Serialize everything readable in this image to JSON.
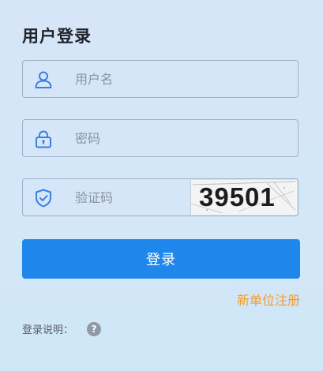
{
  "form": {
    "title": "用户登录",
    "username": {
      "placeholder": "用户名",
      "value": ""
    },
    "password": {
      "placeholder": "密码",
      "value": ""
    },
    "captcha": {
      "placeholder": "验证码",
      "value": "",
      "image_text": "39501"
    },
    "login_label": "登录",
    "register_label": "新单位注册",
    "note_label": "登录说明：",
    "help_glyph": "?"
  },
  "colors": {
    "accent": "#1f87ec",
    "icon": "#3a7ee6",
    "register": "#f59a23",
    "help": "#8f99a8"
  },
  "icons": {
    "username": "user-icon",
    "password": "lock-icon",
    "captcha": "shield-check-icon",
    "help": "help-circle-icon"
  }
}
